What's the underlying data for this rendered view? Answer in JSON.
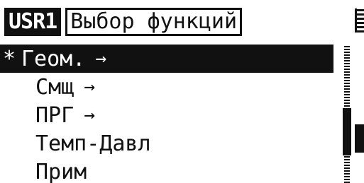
{
  "header": {
    "user_tag": "USR1",
    "title": "Выбор функций"
  },
  "menu": {
    "cursor": "*",
    "items": [
      {
        "label": "Геом.",
        "arrow": "→"
      },
      {
        "label": "Смщ",
        "arrow": "→"
      },
      {
        "label": "ПРГ",
        "arrow": "→"
      },
      {
        "label": "Темп-Давл",
        "arrow": ""
      },
      {
        "label": "Прим",
        "arrow": ""
      }
    ],
    "selected_index": 0
  },
  "scrollbar": {
    "thumb_start_fraction": 0.46,
    "thumb_end_fraction": 0.8
  }
}
